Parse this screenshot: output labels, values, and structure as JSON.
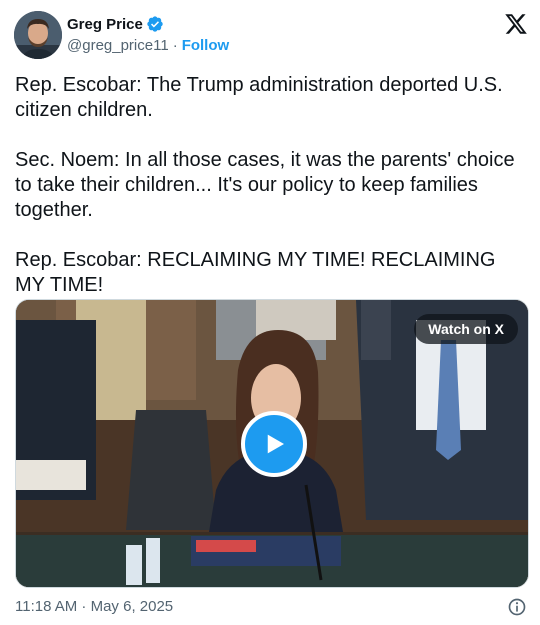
{
  "author": {
    "display_name": "Greg Price",
    "handle": "@greg_price11",
    "separator": "·",
    "follow_label": "Follow",
    "verified_color": "#1d9bf0"
  },
  "tweet": {
    "text": "Rep. Escobar: The Trump administration deported U.S. citizen children.\n\nSec. Noem: In all those cases, it was the parents' choice to take their children... It's our policy to keep families together.\n\nRep. Escobar: RECLAIMING MY TIME! RECLAIMING MY TIME!"
  },
  "media": {
    "watch_label": "Watch on X",
    "play_icon": "play-icon"
  },
  "footer": {
    "timestamp": "11:18 AM · May 6, 2025",
    "info_icon": "info-icon"
  },
  "colors": {
    "accent": "#1d9bf0",
    "text_primary": "#0f1419",
    "text_secondary": "#536471"
  }
}
